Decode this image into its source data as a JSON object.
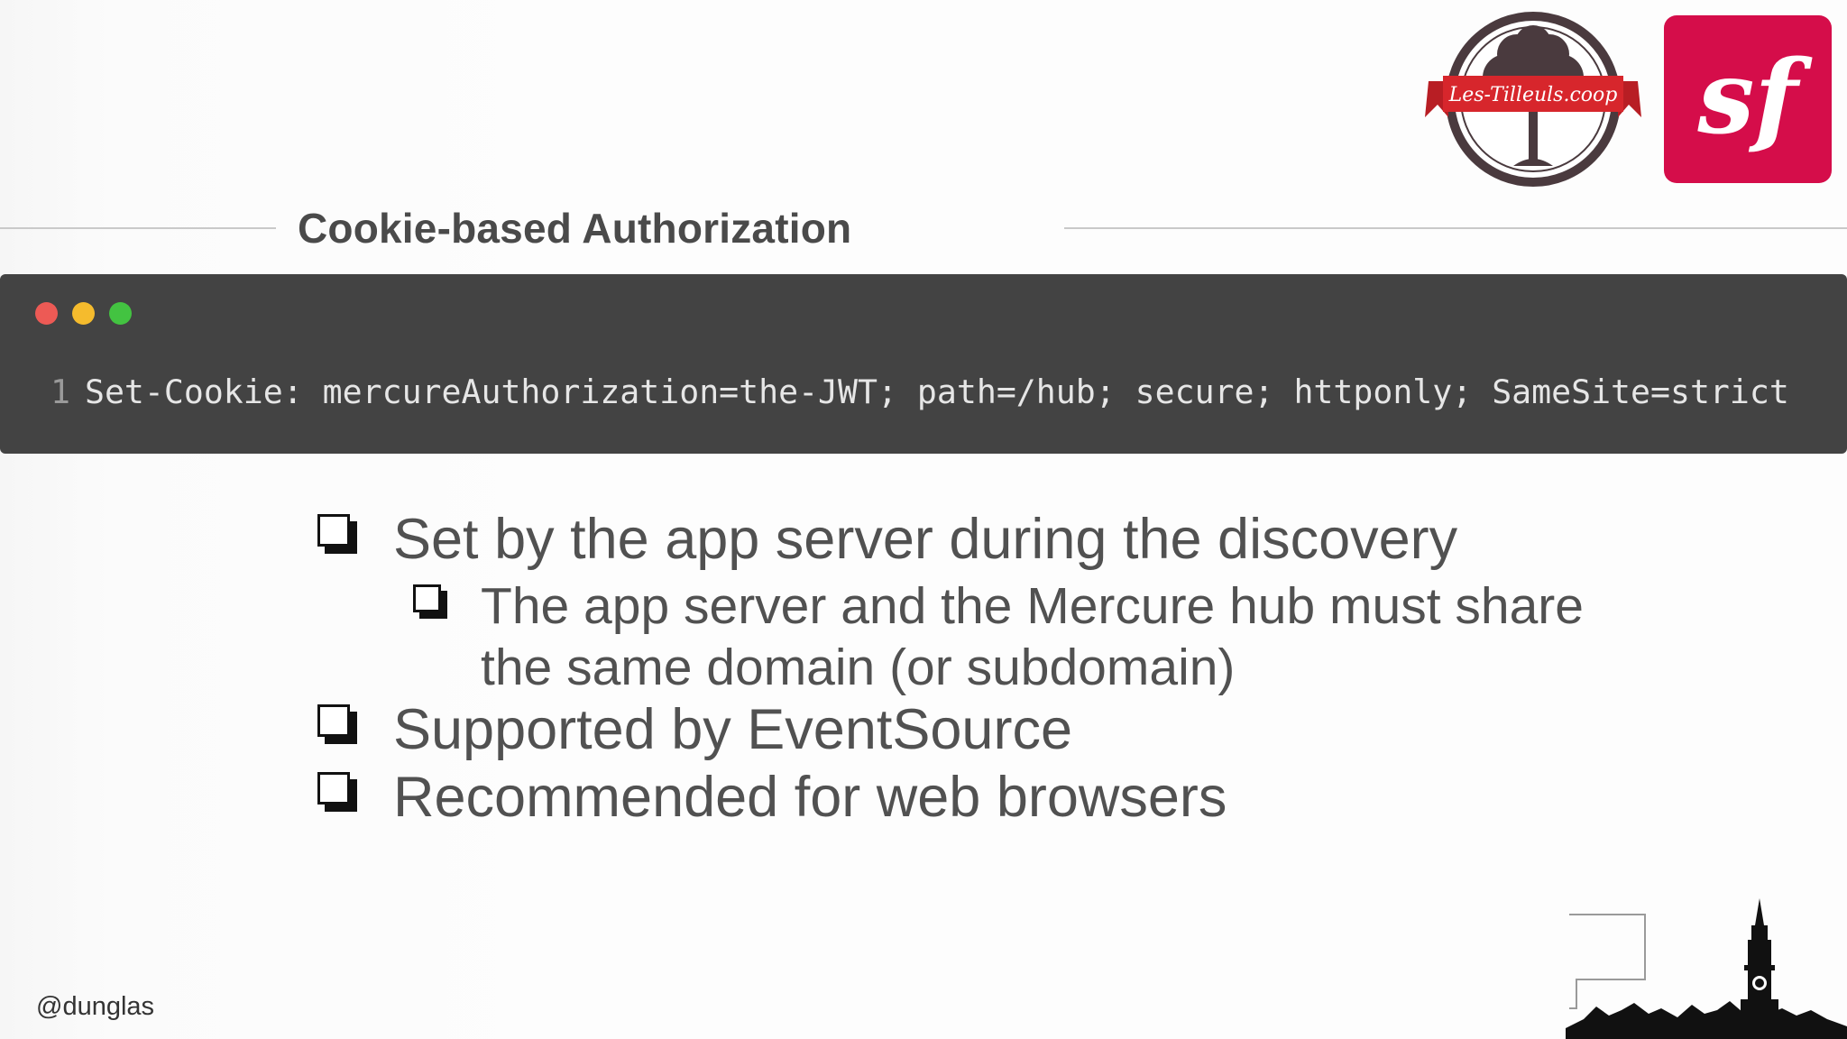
{
  "slide": {
    "title": "Cookie-based Authorization",
    "handle": "@dunglas"
  },
  "logos": {
    "tilleuls_text": "Les-Tilleuls.coop",
    "symfony_mark": "sf",
    "tilleuls_color": "#4a3a3e",
    "tilleuls_ribbon_color": "#d7262c",
    "symfony_color": "#d50d4a"
  },
  "code": {
    "line_number": "1",
    "line": "Set-Cookie: mercureAuthorization=the-JWT; path=/hub; secure; httponly; SameSite=strict",
    "window_dots": [
      "red-dot",
      "yellow-dot",
      "green-dot"
    ]
  },
  "bullets": [
    {
      "level": 1,
      "text": "Set by the app server during the discovery"
    },
    {
      "level": 2,
      "text": "The app server and the Mercure hub must share the same domain (or subdomain)"
    },
    {
      "level": 1,
      "text": "Supported by EventSource"
    },
    {
      "level": 1,
      "text": "Recommended for web browsers"
    }
  ]
}
